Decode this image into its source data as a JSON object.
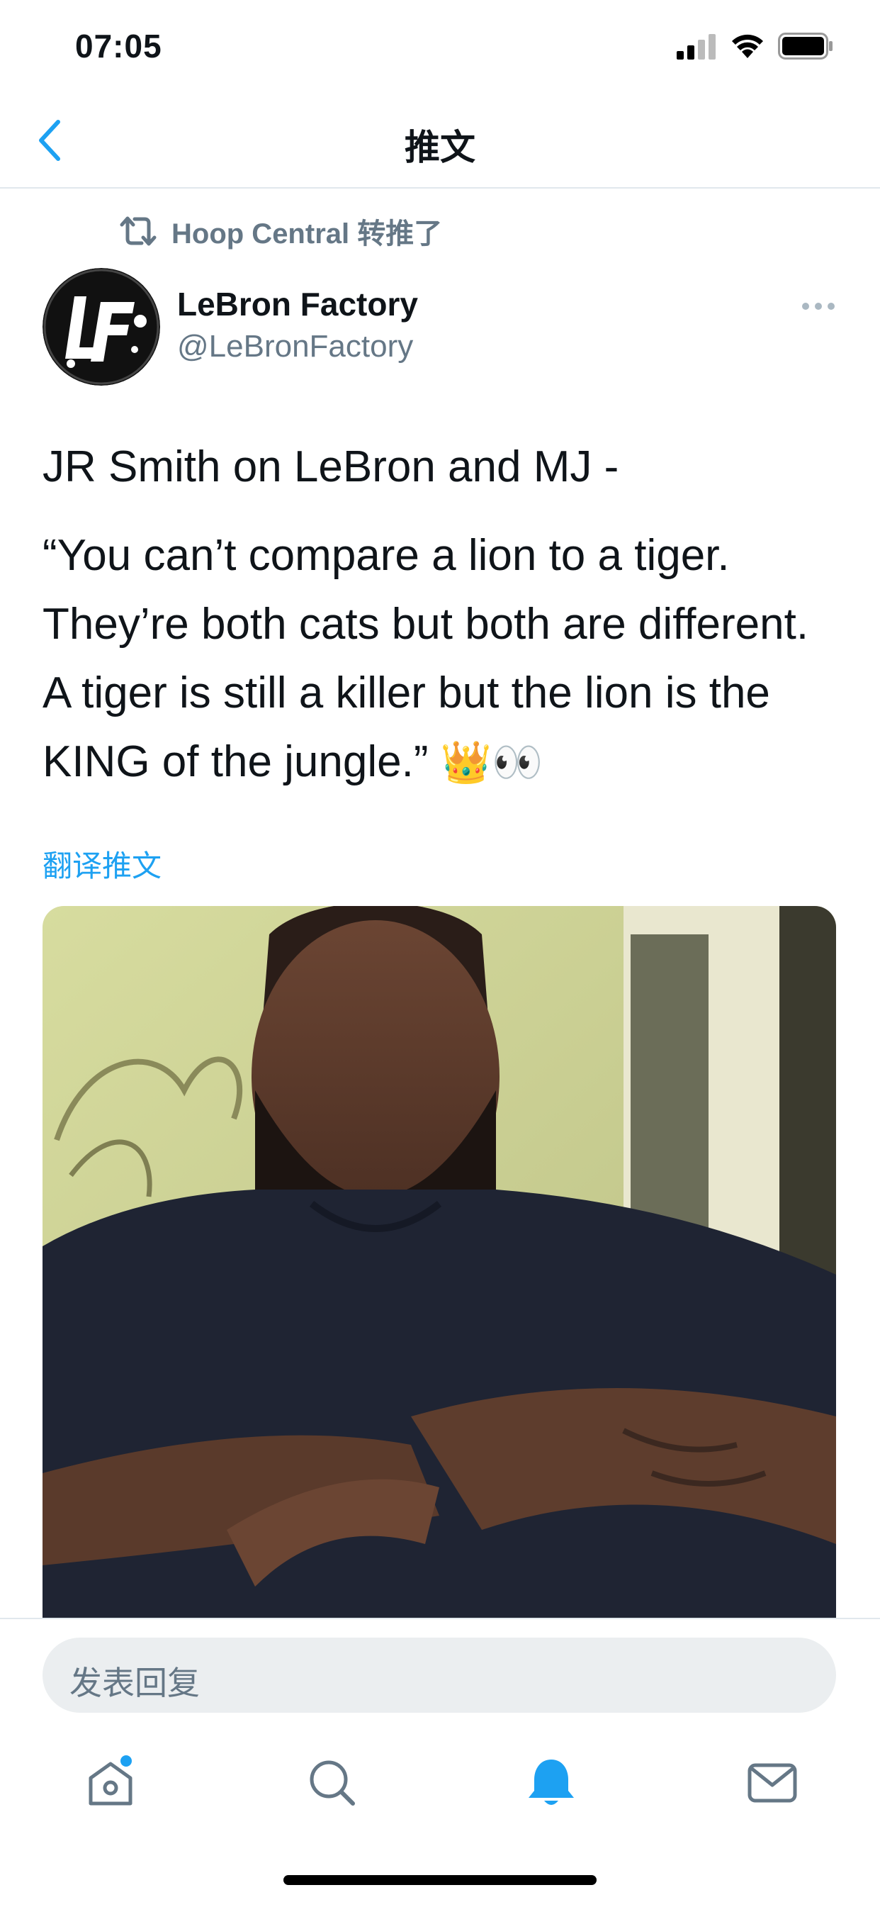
{
  "status_bar": {
    "time": "07:05"
  },
  "nav": {
    "title": "推文"
  },
  "retweet": {
    "text": "Hoop Central 转推了"
  },
  "author": {
    "name": "LeBron Factory",
    "handle": "@LeBronFactory"
  },
  "tweet": {
    "line1": "JR Smith on LeBron and MJ -",
    "body": "“You can’t compare a lion to a tiger. They’re both cats but both are different. A tiger is still a killer but the lion is the KING of the jungle.”",
    "emoji": "👑👀"
  },
  "translate_label": "翻译推文",
  "reply": {
    "placeholder": "发表回复"
  },
  "tabs": [
    {
      "icon": "home-icon"
    },
    {
      "icon": "search-icon"
    },
    {
      "icon": "notifications-icon"
    },
    {
      "icon": "messages-icon"
    }
  ],
  "colors": {
    "accent": "#1da1f2",
    "secondary_text": "#657786",
    "divider": "#e1e8ed"
  }
}
